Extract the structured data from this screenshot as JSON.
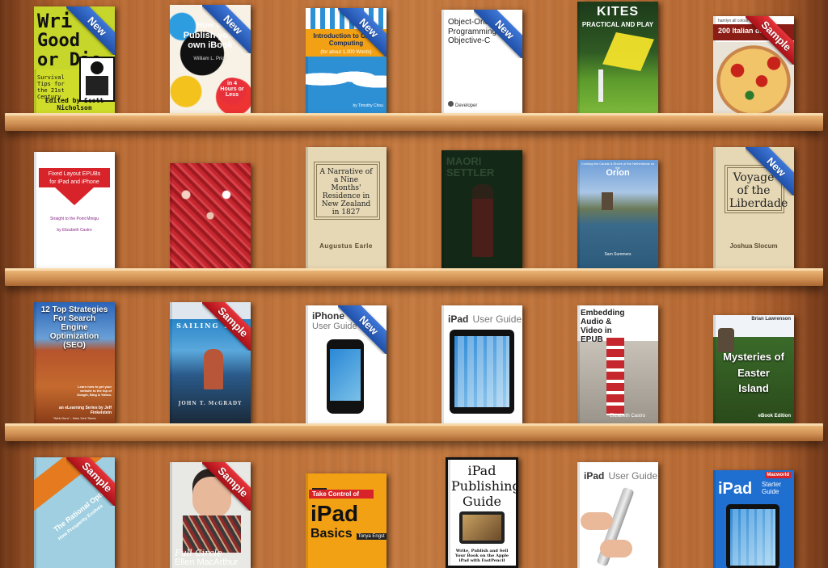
{
  "ribbons": {
    "new": "New",
    "sample": "Sample"
  },
  "shelves": [
    {
      "books": [
        {
          "title": "Write Good or Die",
          "line1": "Wri",
          "line2": "Good",
          "line3": "or Die",
          "subtitle": "Survival Tips for the 21st Century",
          "author": "Edited by Scott Nicholson",
          "ribbon": "new"
        },
        {
          "title": "How to Publish your own iBook",
          "line1": "How to",
          "line2": "Publish your own iBook",
          "author": "William L. Price",
          "badge": "in 4 Hours or Less",
          "ribbon": "new"
        },
        {
          "title": "Introduction to Cloud Computing",
          "line1": "Introduction to Cloud Computing",
          "line2": "(for about 1,000 Words)",
          "author": "by Timothy Chou",
          "ribbon": "new"
        },
        {
          "title": "Object-Oriented Programming with Objective-C",
          "line1": "Object-Oriented",
          "line2": "Programming with Objective-C",
          "footer": "Developer",
          "ribbon": "new"
        },
        {
          "title": "Kites Practical and Play",
          "line1": "KITES",
          "line2": "PRACTICAL AND PLAY",
          "ribbon": "none"
        },
        {
          "title": "200 Italian Dishes",
          "line1": "hamlyn all colour cookbook",
          "line2": "200 Italian dishes",
          "ribbon": "sample"
        }
      ]
    },
    {
      "books": [
        {
          "title": "Fixed Layout EPUBs for iPad and iPhone",
          "line1": "Fixed Layout EPUBs",
          "line2": "for iPad and iPhone",
          "subtitle": "Straight to the Point Minigu",
          "author": "by Elizabeth Castro",
          "ribbon": "none"
        },
        {
          "title": "Castellers photo cover",
          "ribbon": "none"
        },
        {
          "title": "A Narrative of a Nine Months' Residence in New Zealand in 1827",
          "line1": "A Narrative of a Nine Months' Residence in New Zealand in 1827",
          "author": "Augustus Earle",
          "ribbon": "none"
        },
        {
          "title": "Maori and Settler",
          "line1": "MAORI",
          "line2": "SETTLER",
          "ribbon": "none"
        },
        {
          "title": "Orion",
          "line1": "Cruising the Canals & Rivers of the Netherlands on the",
          "line2": "Orion",
          "author": "Sam Summers",
          "ribbon": "none"
        },
        {
          "title": "Voyage of the Liberdade",
          "line1": "Voyage of the Liberdade",
          "author": "Joshua Slocum",
          "ribbon": "new"
        }
      ]
    },
    {
      "books": [
        {
          "title": "12 Top Strategies For Search Engine Optimization (SEO)",
          "line1": "12 Top Strategies For Search Engine Optimization (SEO)",
          "subtitle": "Learn how to get your website to the top of Google, Bing & Yahoo.",
          "author": "an eLearning Series by Jeff Finkelstein",
          "footer": "\"Web Guru\" - New York Times",
          "ribbon": "none"
        },
        {
          "title": "Sailing the World",
          "line1": "SAILING THE",
          "author": "JOHN T. McGRADY",
          "ribbon": "sample"
        },
        {
          "title": "iPhone User Guide",
          "line1": "iPhone",
          "line2": "User Guide",
          "ribbon": "new"
        },
        {
          "title": "iPad User Guide",
          "line1": "iPad",
          "line2": "User Guide",
          "ribbon": "none"
        },
        {
          "title": "Embedding Audio & Video in EPUB",
          "line1": "Embedding Audio & Video in EPUB",
          "author": "Elizabeth Castro",
          "ribbon": "none"
        },
        {
          "title": "Mysteries of Easter Island",
          "line1": "Mysteries of Easter Island",
          "author": "Brian Lawrenson",
          "footer": "eBook Edition",
          "ribbon": "none"
        }
      ]
    },
    {
      "books": [
        {
          "title": "The Rational Optimist",
          "line1": "The Rational Optim",
          "line2": "How Prosperity Evolves",
          "ribbon": "sample"
        },
        {
          "title": "Full Circle Ellen MacArthur",
          "line1": "Full Circle",
          "line2": "Ellen MacArthur",
          "ribbon": "sample"
        },
        {
          "title": "Take Control of iPad Basics",
          "line1": "Take Control of",
          "line2": "iPad",
          "line3": "Basics",
          "author": "Tonya Engst",
          "ribbon": "none"
        },
        {
          "title": "iPad Publishing Guide",
          "line1": "iPad Publishing Guide",
          "subtitle": "Write, Publish and Sell Your Book on the Apple iPad with FastPencil",
          "ribbon": "none"
        },
        {
          "title": "iPad User Guide (hands)",
          "line1": "iPad",
          "line2": "User Guide",
          "ribbon": "none"
        },
        {
          "title": "Macworld iPad Starter Guide",
          "line1": "Macworld",
          "line2": "iPad",
          "line3": "Starter Guide",
          "ribbon": "none"
        }
      ]
    }
  ]
}
